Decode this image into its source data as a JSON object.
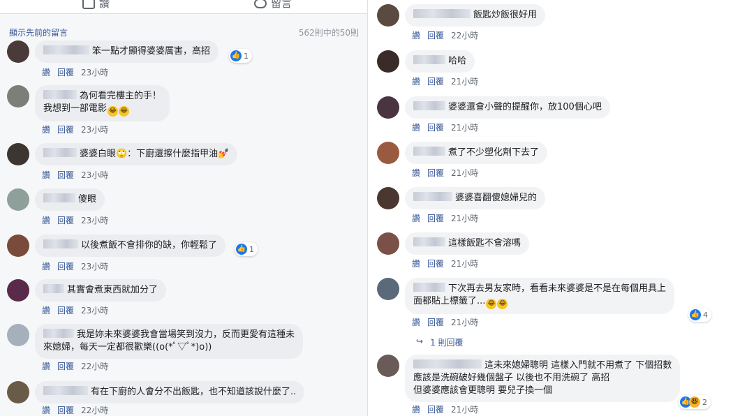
{
  "actions": {
    "like": "讚",
    "comment": "留言"
  },
  "prev": {
    "link": "顯示先前的留言",
    "count": "562則中的50則"
  },
  "meta": {
    "like": "讚",
    "reply": "回覆"
  },
  "left": [
    {
      "text": "笨一點才顯得婆婆厲害，高招",
      "time": "23小時",
      "reactions": "1"
    },
    {
      "line1": "為何看完樓主的手！",
      "line2": "我想到一部電影",
      "time": "23小時"
    },
    {
      "text": "婆婆白眼🙄：下廚還擦什麼指甲油💅",
      "time": "23小時"
    },
    {
      "text": "傻眼",
      "time": "23小時"
    },
    {
      "text": "以後煮飯不會排你的缺，你輕鬆了",
      "time": "23小時",
      "reactions": "1"
    },
    {
      "text": "其實會煮東西就加分了",
      "time": "23小時"
    },
    {
      "line1": "我是妳未來婆婆我會當場笑到沒力，反而更愛有這種未",
      "line2": "來媳婦，每天一定都很歡樂((o(*ﾟ▽ﾟ*)o))",
      "time": "22小時"
    },
    {
      "text": "有在下廚的人會分不出飯匙，也不知道該說什麼了..",
      "time": "22小時"
    }
  ],
  "right": [
    {
      "text": "飯匙炒飯很好用",
      "time": "22小時"
    },
    {
      "text": "哈哈",
      "time": "21小時"
    },
    {
      "text": "婆婆還會小聲的提醒你，放100個心吧",
      "time": "21小時"
    },
    {
      "text": "煮了不少塑化劑下去了",
      "time": "21小時"
    },
    {
      "text": "婆婆喜翻傻媳婦兒的",
      "time": "21小時"
    },
    {
      "text": "這樣飯匙不會溶嗎",
      "time": "21小時"
    },
    {
      "line1": "下次再去男友家時，看看未來婆婆是不是在每個用具上",
      "line2": "面都貼上標籤了...",
      "time": "21小時",
      "reactions": "4"
    },
    {
      "line1": "這未來媳婦聰明 這樣入門就不用煮了 下個招數",
      "line2": "應該是洗碗破好幾個盤子 以後也不用洗碗了 高招",
      "line3": "但婆婆應該會更聰明 要兒子換一個",
      "time": "21小時",
      "reactions": "2"
    }
  ],
  "reply_link": "1 則回覆"
}
